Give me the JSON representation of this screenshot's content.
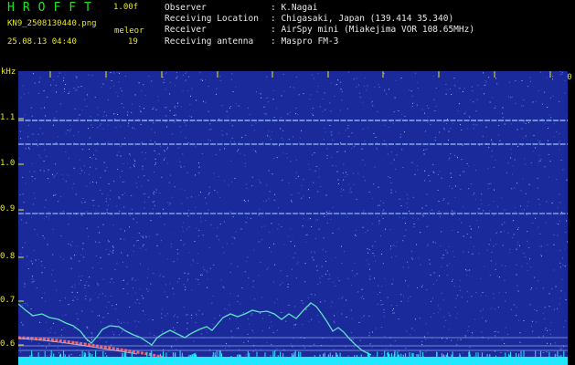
{
  "header": {
    "brand": "HROFFT",
    "version": "1.00f",
    "filename": "KN9_2508130440.png",
    "datetime": "25.08.13 04:40",
    "mode_label": "meleor",
    "count": "19"
  },
  "info": [
    {
      "key": "Observer",
      "value": ": K.Nagai"
    },
    {
      "key": "Receiving Location",
      "value": ": Chigasaki, Japan (139.414 35.340)"
    },
    {
      "key": "Receiver",
      "value": ": AirSpy mini (Miakejima VOR 108.65MHz)"
    },
    {
      "key": "Receiving antenna",
      "value": ": Maspro FM-3"
    }
  ],
  "axis": {
    "unit": "kHz",
    "y_labels": [
      "1.1",
      "1.0",
      "0.9",
      "0.8",
      "0.7",
      "0.6"
    ],
    "x_labels": [
      "0441",
      "0442",
      "0443",
      "0444",
      "0445",
      "0446",
      "0447",
      "0448",
      "0449",
      "0450"
    ]
  },
  "colors": {
    "background": "#1a2a9a",
    "carrier": "#9fc8ff",
    "trace": "#5fe0c8",
    "meteor": "#ff6a6a",
    "text_yellow": "#e8e820",
    "brand_green": "#19e619",
    "baseline": "#22e8ff"
  }
}
